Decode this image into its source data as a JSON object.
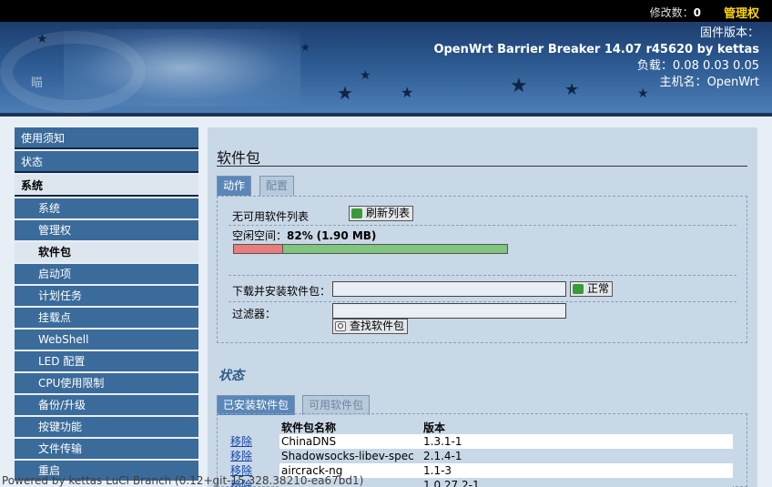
{
  "topbar": {
    "changes_label": "修改数：",
    "changes_count": "0",
    "admin_label": "管理权"
  },
  "banner": {
    "firmware_label": "固件版本：",
    "firmware_value": "OpenWrt Barrier Breaker 14.07 r45620 by kettas",
    "load_label": "负载：",
    "load_value": "0.08 0.03 0.05",
    "hostname_label": "主机名：",
    "hostname_value": "OpenWrt",
    "cat_text": "瞄"
  },
  "sidebar": {
    "top_items": [
      {
        "label": "使用须知"
      },
      {
        "label": "状态"
      },
      {
        "label": "系统"
      }
    ],
    "sub_items": [
      {
        "label": "系统"
      },
      {
        "label": "管理权"
      },
      {
        "label": "软件包"
      },
      {
        "label": "启动项"
      },
      {
        "label": "计划任务"
      },
      {
        "label": "挂载点"
      },
      {
        "label": "WebShell"
      },
      {
        "label": "LED 配置"
      },
      {
        "label": "CPU使用限制"
      },
      {
        "label": "备份/升级"
      },
      {
        "label": "按键功能"
      },
      {
        "label": "文件传输"
      },
      {
        "label": "重启"
      }
    ]
  },
  "main": {
    "page_title": "软件包",
    "tabs": [
      {
        "label": "动作"
      },
      {
        "label": "配置"
      }
    ],
    "no_list_label": "无可用软件列表",
    "refresh_button": "刷新列表",
    "free_space_label": "空闲空间：",
    "free_space_percent": "82%",
    "free_space_size": "(1.90 MB)",
    "used_fraction": 0.18,
    "download_label": "下载并安装软件包：",
    "download_value": "",
    "ok_button": "正常",
    "filter_label": "过滤器：",
    "filter_value": "",
    "find_button": "查找软件包",
    "status_title": "状态",
    "pkg_tabs": [
      {
        "label": "已安装软件包"
      },
      {
        "label": "可用软件包"
      }
    ],
    "pkg_header": {
      "name": "软件包名称",
      "version": "版本"
    },
    "remove_label": "移除",
    "packages": [
      {
        "name": "ChinaDNS",
        "version": "1.3.1-1"
      },
      {
        "name": "Shadowsocks-libev-spec",
        "version": "2.1.4-1"
      },
      {
        "name": "aircrack-ng",
        "version": "1.1-3"
      },
      {
        "name": "",
        "version": "1.0.27.2-1"
      }
    ]
  },
  "footer": "Powered by kettas LuCI Branch (0.12+git-15.328.38210-ea67bd1)",
  "colors": {
    "nav_bg": "#3a6b9a",
    "active_bg": "#dde6ee",
    "tab_active": "#5a87b8",
    "admin": "#ffd700",
    "bar_used": "#e87d7d",
    "bar_free": "#7fc47f"
  }
}
